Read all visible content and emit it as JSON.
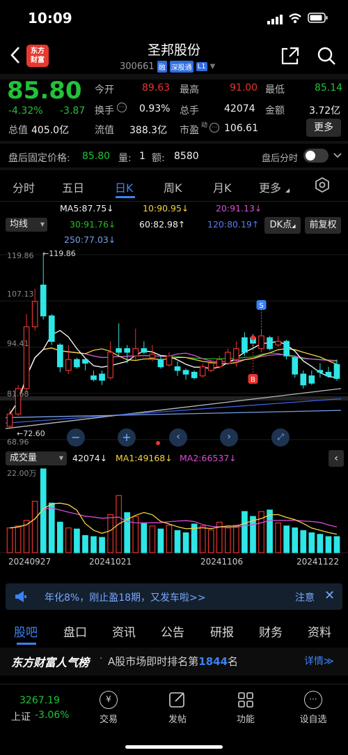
{
  "status_bar": {
    "time": "10:09"
  },
  "header": {
    "title": "圣邦股份",
    "code": "300661",
    "tags": [
      "融",
      "深股通",
      "L1"
    ],
    "logo_text": [
      "东方",
      "财富"
    ]
  },
  "quote": {
    "price": "85.80",
    "change_pct": "-4.32%",
    "change": "-3.87",
    "total_value_label": "总值",
    "total_value": "405.0亿",
    "fields": [
      {
        "label": "今开",
        "value": "89.63"
      },
      {
        "label": "最高",
        "value": "91.00"
      },
      {
        "label": "最低",
        "value": "85.14"
      },
      {
        "label": "换手",
        "value": "0.93%"
      },
      {
        "label": "总手",
        "value": "42074"
      },
      {
        "label": "金额",
        "value": "3.72亿"
      },
      {
        "label": "流值",
        "value": "388.3亿"
      },
      {
        "label": "市盈",
        "sup": "动",
        "value": "106.61"
      }
    ],
    "more_label": "更多"
  },
  "after_hours": {
    "label": "盘后固定价格:",
    "price": "85.80",
    "vol_label": "量:",
    "vol": "1",
    "amt_label": "额:",
    "amt": "8580",
    "toggle_label": "盘后分时"
  },
  "period_tabs": [
    "分时",
    "五日",
    "日K",
    "周K",
    "月K",
    "更多"
  ],
  "indicators": {
    "selector": "均线",
    "ma5": "MA5:87.75↓",
    "ma10": "10:90.95↓",
    "ma20": "20:91.13↓",
    "ma30": "30:91.76↓",
    "ma60": "60:82.98↑",
    "ma120": "120:80.19↑",
    "ma250": "250:77.03↓",
    "dk_label": "DK点",
    "adjust_label": "前复权"
  },
  "kline_axis": {
    "labels": [
      "119.86",
      "107.13",
      "94.41",
      "81.68",
      "68.96"
    ],
    "high_marker": "←119.86",
    "low_marker": "←72.60",
    "s_marker": "S",
    "b_marker": "B"
  },
  "volume": {
    "selector": "成交量",
    "vol": "42074↓",
    "ma1": "MA1:49168↓",
    "ma2": "MA2:66537↓",
    "axis_top": "22.00万"
  },
  "dates": [
    "20240927",
    "20241021",
    "20241106",
    "20241122"
  ],
  "banner": {
    "text": "年化8%，刚止盈18期，又发车啦>>",
    "action": "注意"
  },
  "bottom_tabs": [
    "股吧",
    "盘口",
    "资讯",
    "公告",
    "研报",
    "财务",
    "资料"
  ],
  "popularity": {
    "title": "东方财富人气榜",
    "text_pre": "A股市场即时排名第",
    "rank": "1844",
    "text_post": "名",
    "detail": "详情"
  },
  "bottom_nav": {
    "index_value": "3267.19",
    "index_label": "上证",
    "index_change": "-3.06%",
    "items": [
      "交易",
      "发帖",
      "功能",
      "设自选"
    ]
  },
  "chart_data": {
    "type": "candlestick",
    "ylim": [
      68.96,
      119.86
    ],
    "candles": [
      {
        "o": 72.6,
        "c": 76.0,
        "h": 77.5,
        "l": 72.6,
        "up": true
      },
      {
        "o": 76.0,
        "c": 83.0,
        "h": 84.0,
        "l": 75.5,
        "up": true
      },
      {
        "o": 83.0,
        "c": 100.0,
        "h": 103.5,
        "l": 82.0,
        "up": true
      },
      {
        "o": 100.0,
        "c": 107.0,
        "h": 110.5,
        "l": 99.0,
        "up": true
      },
      {
        "o": 111.5,
        "c": 103.0,
        "h": 119.86,
        "l": 102.0,
        "up": false
      },
      {
        "o": 103.0,
        "c": 96.0,
        "h": 103.5,
        "l": 95.0,
        "up": false
      },
      {
        "o": 95.0,
        "c": 89.0,
        "h": 95.5,
        "l": 87.5,
        "up": false
      },
      {
        "o": 88.0,
        "c": 91.0,
        "h": 95.0,
        "l": 87.0,
        "up": true
      },
      {
        "o": 89.0,
        "c": 91.0,
        "h": 91.5,
        "l": 88.5,
        "up": false
      },
      {
        "o": 91.0,
        "c": 90.0,
        "h": 91.5,
        "l": 88.0,
        "up": false
      },
      {
        "o": 86.5,
        "c": 85.5,
        "h": 88.0,
        "l": 85.0,
        "up": false
      },
      {
        "o": 85.3,
        "c": 87.0,
        "h": 88.0,
        "l": 84.0,
        "up": false
      },
      {
        "o": 86.0,
        "c": 93.0,
        "h": 96.0,
        "l": 85.5,
        "up": true
      },
      {
        "o": 93.0,
        "c": 94.0,
        "h": 101.0,
        "l": 92.0,
        "up": false
      },
      {
        "o": 94.0,
        "c": 93.0,
        "h": 95.0,
        "l": 90.0,
        "up": false
      },
      {
        "o": 92.0,
        "c": 94.0,
        "h": 99.5,
        "l": 91.0,
        "up": true
      },
      {
        "o": 94.0,
        "c": 93.0,
        "h": 96.0,
        "l": 92.5,
        "up": false
      },
      {
        "o": 92.5,
        "c": 91.5,
        "h": 95.0,
        "l": 90.5,
        "up": true
      },
      {
        "o": 91.0,
        "c": 89.0,
        "h": 92.0,
        "l": 88.5,
        "up": false
      },
      {
        "o": 89.5,
        "c": 92.0,
        "h": 93.0,
        "l": 89.0,
        "up": true
      },
      {
        "o": 88.0,
        "c": 89.0,
        "h": 90.5,
        "l": 86.5,
        "up": false
      },
      {
        "o": 88.0,
        "c": 87.0,
        "h": 88.5,
        "l": 85.5,
        "up": false
      },
      {
        "o": 86.0,
        "c": 87.5,
        "h": 88.0,
        "l": 85.5,
        "up": false
      },
      {
        "o": 86.5,
        "c": 89.0,
        "h": 90.0,
        "l": 86.0,
        "up": true
      },
      {
        "o": 88.0,
        "c": 90.0,
        "h": 91.0,
        "l": 87.5,
        "up": true
      },
      {
        "o": 89.0,
        "c": 91.0,
        "h": 92.0,
        "l": 88.5,
        "up": true
      },
      {
        "o": 90.0,
        "c": 93.0,
        "h": 94.0,
        "l": 89.5,
        "up": true
      },
      {
        "o": 91.0,
        "c": 94.0,
        "h": 96.0,
        "l": 89.0,
        "up": true
      },
      {
        "o": 93.0,
        "c": 97.0,
        "h": 98.5,
        "l": 92.0,
        "up": false
      },
      {
        "o": 97.0,
        "c": 95.5,
        "h": 98.0,
        "l": 94.0,
        "up": false
      },
      {
        "o": 94.0,
        "c": 97.5,
        "h": 99.0,
        "l": 93.0,
        "up": true
      },
      {
        "o": 97.0,
        "c": 94.0,
        "h": 97.5,
        "l": 93.5,
        "up": false
      },
      {
        "o": 95.0,
        "c": 96.0,
        "h": 97.5,
        "l": 94.5,
        "up": true
      },
      {
        "o": 96.0,
        "c": 92.0,
        "h": 96.5,
        "l": 91.0,
        "up": false
      },
      {
        "o": 91.5,
        "c": 87.0,
        "h": 92.0,
        "l": 86.0,
        "up": false
      },
      {
        "o": 87.0,
        "c": 84.0,
        "h": 88.0,
        "l": 83.0,
        "up": false
      },
      {
        "o": 84.5,
        "c": 86.5,
        "h": 88.0,
        "l": 84.0,
        "up": false
      },
      {
        "o": 88.0,
        "c": 87.5,
        "h": 90.0,
        "l": 86.0,
        "up": false
      },
      {
        "o": 87.5,
        "c": 86.5,
        "h": 89.0,
        "l": 86.0,
        "up": false
      },
      {
        "o": 89.63,
        "c": 85.8,
        "h": 91.0,
        "l": 85.14,
        "up": false
      }
    ],
    "volume_max": 220000,
    "volumes": [
      {
        "v": 65000,
        "up": true
      },
      {
        "v": 70000,
        "up": true
      },
      {
        "v": 85000,
        "up": true
      },
      {
        "v": 135000,
        "up": true
      },
      {
        "v": 220000,
        "up": false
      },
      {
        "v": 130000,
        "up": false
      },
      {
        "v": 80000,
        "up": false
      },
      {
        "v": 65000,
        "up": true
      },
      {
        "v": 62000,
        "up": false
      },
      {
        "v": 45000,
        "up": false
      },
      {
        "v": 42000,
        "up": false
      },
      {
        "v": 40000,
        "up": false
      },
      {
        "v": 100000,
        "up": true
      },
      {
        "v": 150000,
        "up": true
      },
      {
        "v": 105000,
        "up": false
      },
      {
        "v": 95000,
        "up": true
      },
      {
        "v": 78000,
        "up": false
      },
      {
        "v": 70000,
        "up": true
      },
      {
        "v": 62000,
        "up": false
      },
      {
        "v": 72000,
        "up": true
      },
      {
        "v": 58000,
        "up": false
      },
      {
        "v": 52000,
        "up": false
      },
      {
        "v": 75000,
        "up": false
      },
      {
        "v": 70000,
        "up": true
      },
      {
        "v": 60000,
        "up": true
      },
      {
        "v": 80000,
        "up": true
      },
      {
        "v": 65000,
        "up": true
      },
      {
        "v": 72000,
        "up": true
      },
      {
        "v": 108000,
        "up": false
      },
      {
        "v": 95000,
        "up": false
      },
      {
        "v": 108000,
        "up": true
      },
      {
        "v": 112000,
        "up": false
      },
      {
        "v": 78000,
        "up": true
      },
      {
        "v": 70000,
        "up": false
      },
      {
        "v": 65000,
        "up": false
      },
      {
        "v": 58000,
        "up": false
      },
      {
        "v": 52000,
        "up": false
      },
      {
        "v": 48000,
        "up": false
      },
      {
        "v": 42000,
        "up": false
      },
      {
        "v": 42074,
        "up": false
      }
    ],
    "colors": {
      "up": "#e8342e",
      "down": "#2ee6e6",
      "ma5": "#ffffff",
      "ma10": "#f5d442",
      "ma20": "#d94bd9",
      "ma30": "#22b322",
      "ma60": "#bbbbbb",
      "ma120": "#3d5fe0",
      "ma250": "#7a9fe8"
    }
  }
}
